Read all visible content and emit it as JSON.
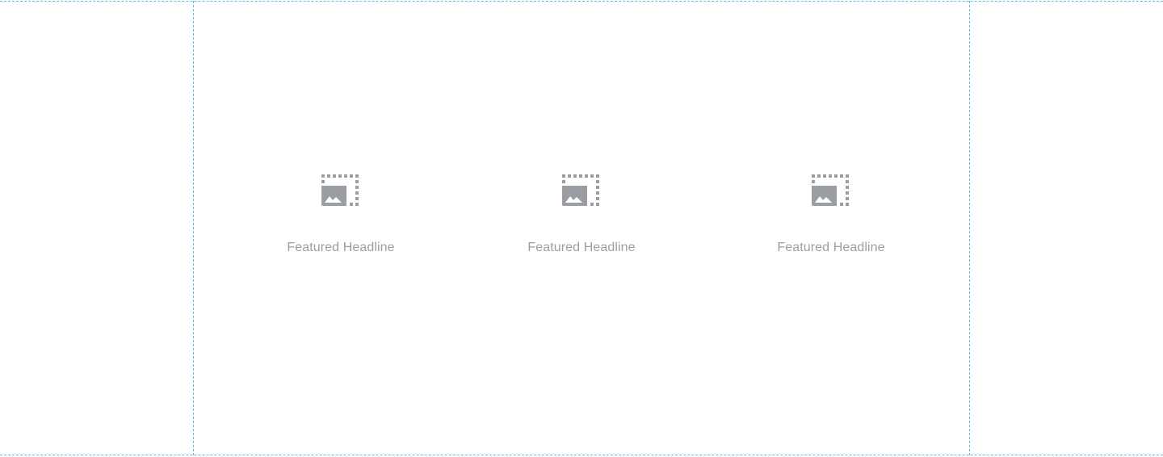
{
  "colors": {
    "guide": "#5bc0de",
    "placeholder": "#9a9ea3"
  },
  "features": [
    {
      "icon": "image-placeholder-icon",
      "headline": "Featured Headline"
    },
    {
      "icon": "image-placeholder-icon",
      "headline": "Featured Headline"
    },
    {
      "icon": "image-placeholder-icon",
      "headline": "Featured Headline"
    }
  ]
}
